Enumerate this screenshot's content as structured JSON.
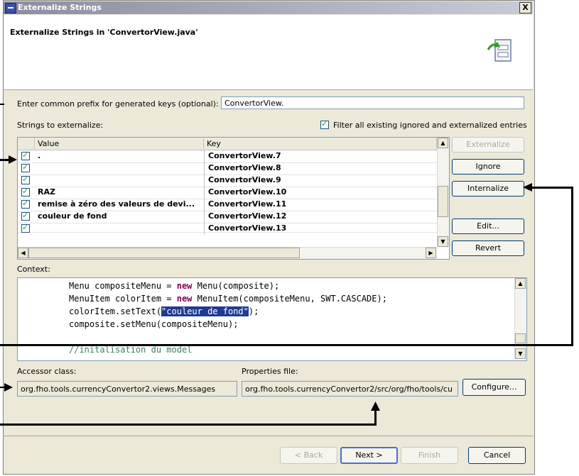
{
  "window": {
    "title": "Externalize Strings",
    "close_glyph": "X"
  },
  "header": {
    "title": "Externalize Strings in 'ConvertorView.java'"
  },
  "prefix": {
    "label": "Enter common prefix for generated keys (optional):",
    "value": "ConvertorView."
  },
  "strings_label": "Strings to externalize:",
  "filter_checkbox": {
    "label": "Filter all existing ignored and externalized entries",
    "checked": true
  },
  "table": {
    "columns": [
      "Value",
      "Key"
    ],
    "rows": [
      {
        "checked": true,
        "value": ".",
        "key": "ConvertorView.7"
      },
      {
        "checked": true,
        "value": "",
        "key": "ConvertorView.8"
      },
      {
        "checked": true,
        "value": "",
        "key": "ConvertorView.9"
      },
      {
        "checked": true,
        "value": "RAZ",
        "key": "ConvertorView.10"
      },
      {
        "checked": true,
        "value": "remise à zéro des valeurs de devi...",
        "key": "ConvertorView.11"
      },
      {
        "checked": true,
        "value": "couleur de fond",
        "key": "ConvertorView.12"
      },
      {
        "checked": true,
        "value": "",
        "key": "ConvertorView.13"
      }
    ]
  },
  "side_buttons": {
    "externalize": "Externalize",
    "ignore": "Ignore",
    "internalize": "Internalize",
    "edit": "Edit...",
    "revert": "Revert"
  },
  "context": {
    "label": "Context:",
    "line1_a": "Menu compositeMenu = ",
    "line1_kw": "new",
    "line1_b": " Menu(composite);",
    "line2_a": "MenuItem colorItem = ",
    "line2_kw": "new",
    "line2_b": " MenuItem(compositeMenu, SWT.CASCADE);",
    "line3_a": "colorItem.setText(",
    "line3_str": "\"couleur de fond\"",
    "line3_b": ");",
    "line4": "composite.setMenu(compositeMenu);",
    "line5": "//initalisation du model"
  },
  "accessor": {
    "label": "Accessor class:",
    "value": "org.fho.tools.currencyConvertor2.views.Messages"
  },
  "properties": {
    "label": "Properties file:",
    "value": "org.fho.tools.currencyConvertor2/src/org/fho/tools/cu"
  },
  "configure_button": "Configure...",
  "footer": {
    "back": "< Back",
    "next": "Next >",
    "finish": "Finish",
    "cancel": "Cancel"
  },
  "colors": {
    "title_gradient_start": "#8a8d9f",
    "selection": "#1f3b8f",
    "keyword": "#7f0055",
    "comment": "#3f7f5f"
  }
}
